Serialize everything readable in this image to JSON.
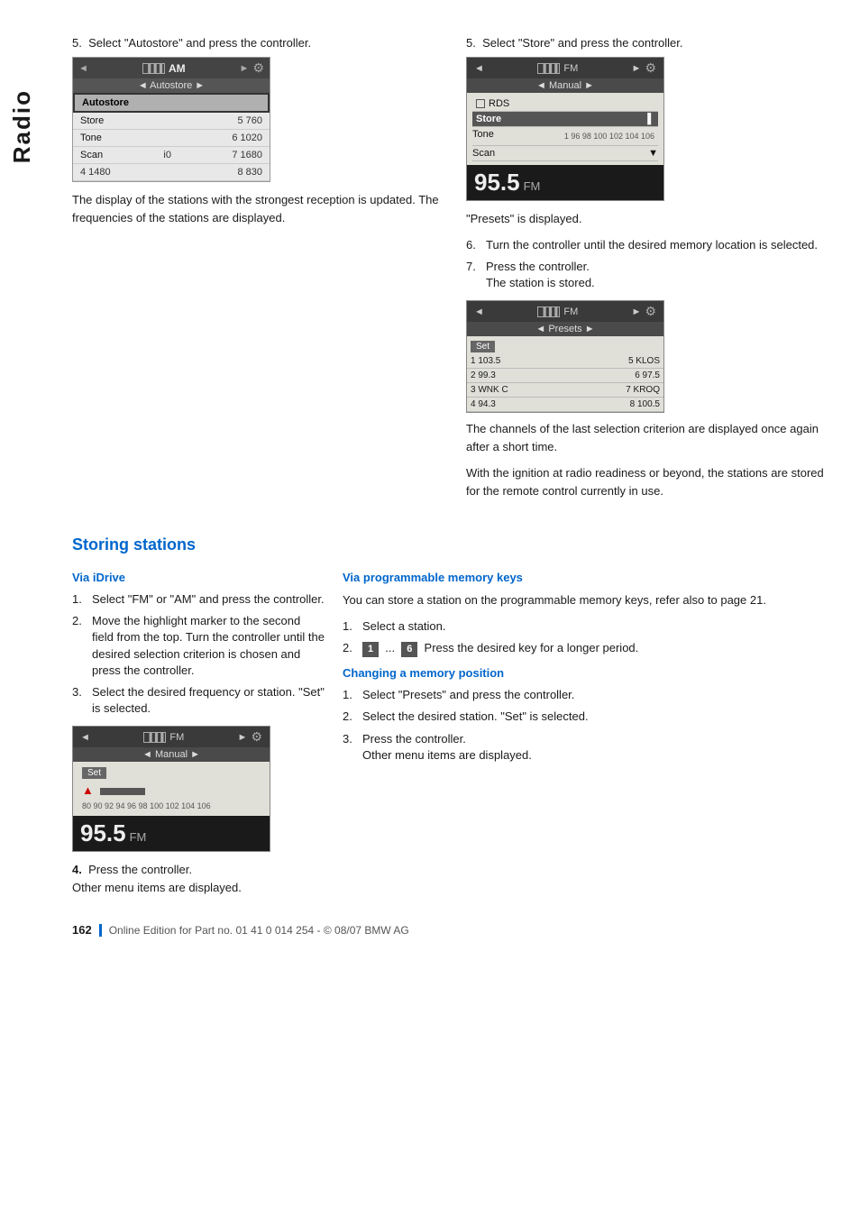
{
  "sidebar": {
    "label": "Radio"
  },
  "top_section": {
    "left": {
      "step": "5.",
      "step_text": "Select \"Autostore\" and press the controller.",
      "screen": {
        "top_bar_left": "◄",
        "top_bar_mode": "AM",
        "top_bar_right": "►",
        "top_bar_icon": "⚙",
        "sub_bar_text": "◄ Autostore ►",
        "menu_items": [
          {
            "label": "Autostore",
            "selected": true,
            "freq": ""
          },
          {
            "label": "Store",
            "selected": false,
            "freq": "5 760"
          },
          {
            "label": "Tone",
            "selected": false,
            "freq": "6 1020"
          },
          {
            "label": "Scan",
            "selected": false,
            "freq2": "i0",
            "freq": "7 1680"
          },
          {
            "label": "",
            "selected": false,
            "freq": "4 1480",
            "freq2": "8 830"
          }
        ]
      },
      "body_text": "The display of the stations with the strongest reception is updated. The frequencies of the stations are displayed."
    },
    "right": {
      "step": "5.",
      "step_text": "Select \"Store\" and press the controller.",
      "screen": {
        "top_bar_left": "◄",
        "top_bar_mode": "FM",
        "top_bar_right": "►",
        "top_bar_icon": "⚙",
        "sub_bar_text": "◄ Manual ►",
        "rds_label": "RDS",
        "menu_items": [
          {
            "label": "Store",
            "selected": true
          },
          {
            "label": "Tone",
            "selected": false
          },
          {
            "label": "Scan",
            "selected": false
          }
        ],
        "slider_text": "1  96  98 100 102 104 106",
        "freq_big": "95.5",
        "freq_unit": "FM"
      },
      "body1": "\"Presets\" is displayed.",
      "step6": "6.",
      "step6_text": "Turn the controller until the desired memory location is selected.",
      "step7": "7.",
      "step7_text": "Press the controller.",
      "step7_sub": "The station is stored.",
      "presets_screen": {
        "top_bar_left": "◄",
        "top_bar_mode": "FM",
        "top_bar_right": "►",
        "top_bar_icon": "⚙",
        "sub_bar_text": "◄ Presets ►",
        "set_label": "Set",
        "rows": [
          {
            "col1": "1 103.5",
            "col2": "5 KLOS"
          },
          {
            "col1": "2 99.3",
            "col2": "6 97.5"
          },
          {
            "col1": "3 WNK C",
            "col2": "7 KROQ"
          },
          {
            "col1": "4 94.3",
            "col2": "8 100.5"
          }
        ]
      },
      "body2": "The channels of the last selection criterion are displayed once again after a short time.",
      "body3": "With the ignition at radio readiness or beyond, the stations are stored for the remote control currently in use."
    }
  },
  "storing_section": {
    "heading": "Storing stations",
    "via_idrive_heading": "Via iDrive",
    "steps": [
      {
        "num": "1.",
        "text": "Select \"FM\" or \"AM\" and press the controller."
      },
      {
        "num": "2.",
        "text": "Move the highlight marker to the second field from the top. Turn the controller until the desired selection criterion is chosen and press the controller."
      },
      {
        "num": "3.",
        "text": "Select the desired frequency or station. \"Set\" is selected."
      }
    ],
    "screen": {
      "top_bar_left": "◄",
      "top_bar_mode": "FM",
      "top_bar_right": "►",
      "top_bar_icon": "⚙",
      "sub_bar_text": "◄ Manual ►",
      "set_label": "Set",
      "cursor_label": "▲",
      "slider_text": "80  90 92  94  96  98 100 102 104 106",
      "freq_big": "95.5",
      "freq_unit": "FM"
    },
    "step4": "4.",
    "step4_text": "Press the controller.",
    "step4_sub": "Other menu items are displayed.",
    "via_memory_heading": "Via programmable memory keys",
    "memory_body": "You can store a station on the programmable memory keys, refer also to page 21.",
    "memory_steps": [
      {
        "num": "1.",
        "text": "Select a station."
      },
      {
        "num": "2.",
        "text_pre": "",
        "key1": "1",
        "ellipsis": "...",
        "key2": "6",
        "text_post": "Press the desired key for a longer period."
      }
    ],
    "changing_heading": "Changing a memory position",
    "changing_steps": [
      {
        "num": "1.",
        "text": "Select \"Presets\" and press the controller."
      },
      {
        "num": "2.",
        "text": "Select the desired station. \"Set\" is selected."
      },
      {
        "num": "3.",
        "text": "Press the controller.",
        "sub": "Other menu items are displayed."
      }
    ]
  },
  "footer": {
    "page_num": "162",
    "footer_text": "Online Edition for Part no. 01 41 0 014 254 - © 08/07 BMW AG"
  }
}
